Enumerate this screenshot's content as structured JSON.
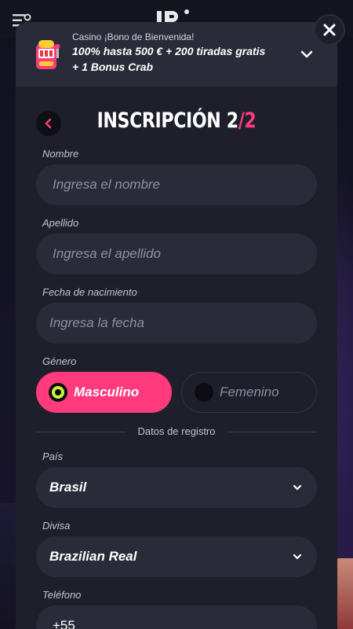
{
  "bonus": {
    "kicker": "Casino ¡Bono de Bienvenida!",
    "title_line1": "100% hasta 500 € + 200 tiradas gratis",
    "title_line2": "+ 1 Bonus Crab"
  },
  "form": {
    "title_prefix": "INSCRIPCIÓN 2",
    "title_slash": "/",
    "title_total": "2",
    "first_name": {
      "label": "Nombre",
      "placeholder": "Ingresa el nombre"
    },
    "last_name": {
      "label": "Apellido",
      "placeholder": "Ingresa el apellido"
    },
    "birth_date": {
      "label": "Fecha de nacimiento",
      "placeholder": "Ingresa la fecha"
    },
    "gender": {
      "label": "Género",
      "options": [
        "Masculino",
        "Femenino"
      ],
      "selected": "Masculino"
    },
    "divider_text": "Datos de registro",
    "country": {
      "label": "País",
      "value": "Brasil"
    },
    "currency": {
      "label": "Divisa",
      "value": "Brazilian Real"
    },
    "phone": {
      "label": "Teléfono",
      "prefix": "+55"
    }
  },
  "colors": {
    "accent": "#ff3b7d",
    "radio_selected": "#c6f23a",
    "modal_bg": "#1e1f2b",
    "field_bg": "#2a2b38"
  },
  "icons": [
    "menu-icon",
    "logo-icon",
    "close-icon",
    "slot-machine-icon",
    "chevron-down-icon",
    "chevron-left-icon"
  ]
}
